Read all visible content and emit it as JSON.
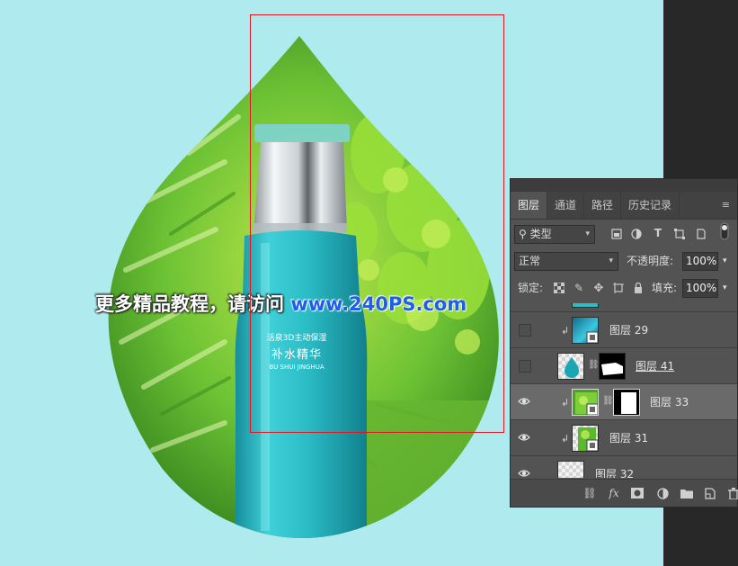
{
  "watermark": {
    "cn_text": "更多精品教程，请访问",
    "url_text": "www.240PS.com"
  },
  "product": {
    "line1": "活泉3D主动保湿",
    "line2": "补水精华",
    "line3": "BU SHUI JINGHUA"
  },
  "panel": {
    "tabs": [
      "图层",
      "通道",
      "路径",
      "历史记录"
    ],
    "tab_menu": "≡",
    "filter": {
      "value": "类型"
    },
    "blend_mode": {
      "value": "正常"
    },
    "opacity": {
      "label": "不透明度:",
      "value": "100%"
    },
    "lock": {
      "label": "锁定:"
    },
    "fill": {
      "label": "填充:",
      "value": "100%"
    },
    "layers": [
      {
        "name": "图层 29",
        "visible": false,
        "clipped": true,
        "has_mask": false
      },
      {
        "name": "图层 41",
        "visible": false,
        "clipped": false,
        "has_mask": true
      },
      {
        "name": "图层 33",
        "visible": true,
        "clipped": true,
        "has_mask": true,
        "selected": true
      },
      {
        "name": "图层 31",
        "visible": true,
        "clipped": true,
        "has_mask": false
      },
      {
        "name": "图层 32",
        "visible": true,
        "clipped": false,
        "has_mask": false
      }
    ],
    "bottom_icons": [
      "link-icon",
      "fx-icon",
      "mask-icon",
      "adjustment-icon",
      "folder-icon",
      "new-layer-icon",
      "trash-icon"
    ]
  },
  "colors": {
    "canvas_bg": "#aeeaee",
    "panel_bg": "#535353",
    "selection_border": "#e0141e",
    "bottle": "#2bbcc6",
    "url_blue": "#1e5ee8"
  }
}
